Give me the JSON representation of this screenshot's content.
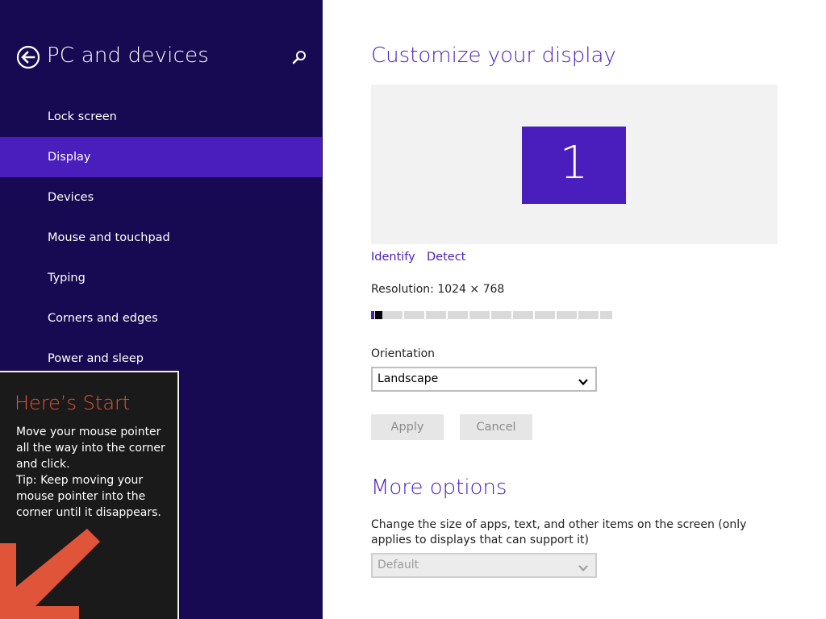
{
  "left_pane": {
    "title": "PC and devices",
    "nav_items": [
      {
        "label": "Lock screen",
        "selected": false
      },
      {
        "label": "Display",
        "selected": true
      },
      {
        "label": "Devices",
        "selected": false
      },
      {
        "label": "Mouse and touchpad",
        "selected": false
      },
      {
        "label": "Typing",
        "selected": false
      },
      {
        "label": "Corners and edges",
        "selected": false
      },
      {
        "label": "Power and sleep",
        "selected": false
      }
    ],
    "icons": {
      "back": "back-arrow-icon",
      "search": "search-icon"
    }
  },
  "tip": {
    "title": "Here’s Start",
    "lines": [
      "Move your mouse pointer all the way into the corner and click.",
      "Tip: Keep moving your mouse pointer into the corner until it disappears."
    ]
  },
  "main": {
    "title": "Customize your display",
    "monitor_number": "1",
    "links": {
      "identify": "Identify",
      "detect": "Detect"
    },
    "resolution_label": "Resolution: 1024 × 768",
    "resolution_slider_position": 0.04,
    "orientation_label": "Orientation",
    "orientation_value": "Landscape",
    "apply_label": "Apply",
    "cancel_label": "Cancel",
    "more_options_title": "More options",
    "size_description": "Change the size of apps, text, and other items on the screen (only applies to displays that can support it)",
    "size_value": "Default"
  },
  "colors": {
    "left_bg": "#180a52",
    "accent": "#4a1dbd",
    "tip_title": "#e0553a",
    "tip_arrow": "#e0553a"
  }
}
